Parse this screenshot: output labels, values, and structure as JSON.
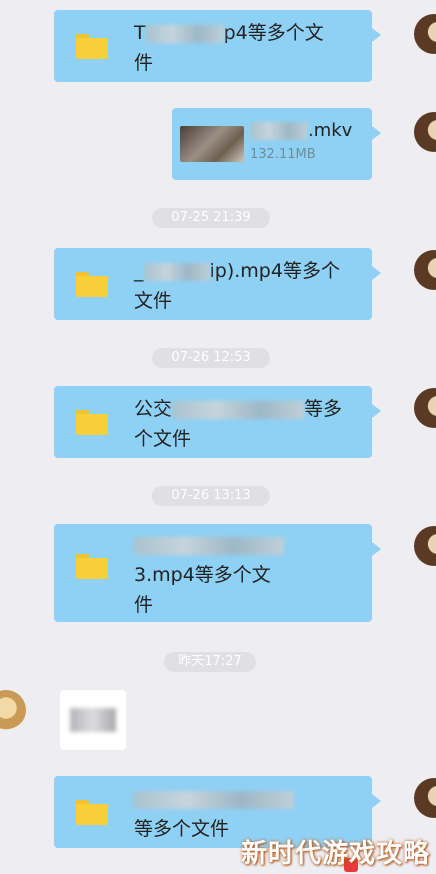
{
  "messages": [
    {
      "type": "file",
      "line1_suffix": "p4等多个文",
      "line2": "件"
    },
    {
      "type": "video",
      "name_suffix": ".mkv",
      "size": "132.11MB"
    },
    {
      "type": "timestamp",
      "text": "07-25 21:39"
    },
    {
      "type": "file",
      "line1_prefix": "_",
      "line1_suffix": "ip).mp4等多个",
      "line2": "文件"
    },
    {
      "type": "timestamp",
      "text": "07-26 12:53"
    },
    {
      "type": "file",
      "line1_prefix": "公交",
      "line1_suffix": "等多",
      "line2": "个文件"
    },
    {
      "type": "timestamp",
      "text": "07-26 13:13"
    },
    {
      "type": "file",
      "line1_prefix": "",
      "line2": "3.mp4等多个文",
      "line3": "件"
    },
    {
      "type": "timestamp",
      "text": "昨天17:27"
    },
    {
      "type": "incoming",
      "content": "image"
    },
    {
      "type": "file",
      "line1_prefix": "",
      "line2": "等多个文件"
    }
  ],
  "watermark": "新时代游戏攻略",
  "colors": {
    "background": "#eeeef2",
    "bubble": "#8fd1f4",
    "folder": "#f6cf3a",
    "timestamp_bg": "#dfdfe4"
  },
  "icons": [
    "folder-icon",
    "video-thumbnail",
    "avatar"
  ]
}
